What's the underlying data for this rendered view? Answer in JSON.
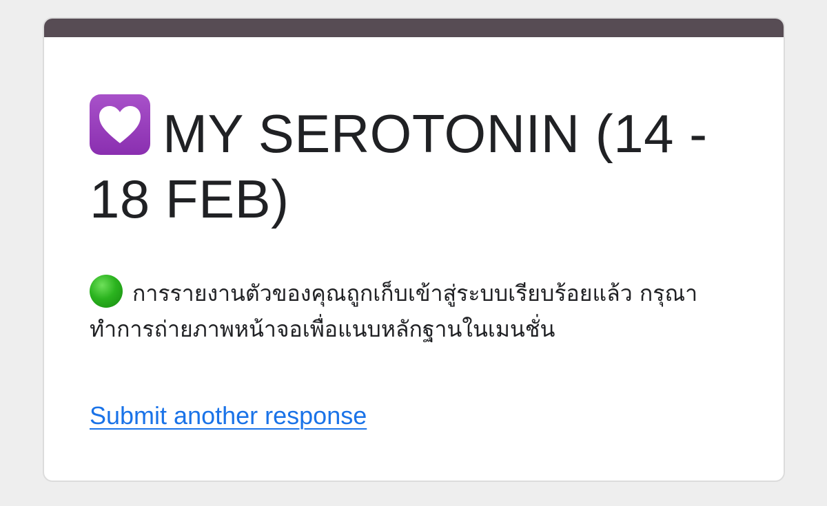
{
  "form": {
    "title": "MY SEROTONIN (14 - 18 FEB)",
    "title_icon": "purple-heart-icon",
    "status_icon": "green-circle-icon",
    "confirmation_message": "การรายงานตัวของคุณถูกเก็บเข้าสู่ระบบเรียบร้อยแล้ว กรุณาทำการถ่ายภาพหน้าจอเพื่อแนบหลักฐานในเมนชั่น",
    "submit_another_label": "Submit another response"
  },
  "colors": {
    "header_bar": "#574c54",
    "background": "#eeeeee",
    "card": "#ffffff",
    "text": "#202124",
    "link": "#1a73e8",
    "heart_tile": "#9b45c0",
    "status_green": "#2bb31f"
  }
}
